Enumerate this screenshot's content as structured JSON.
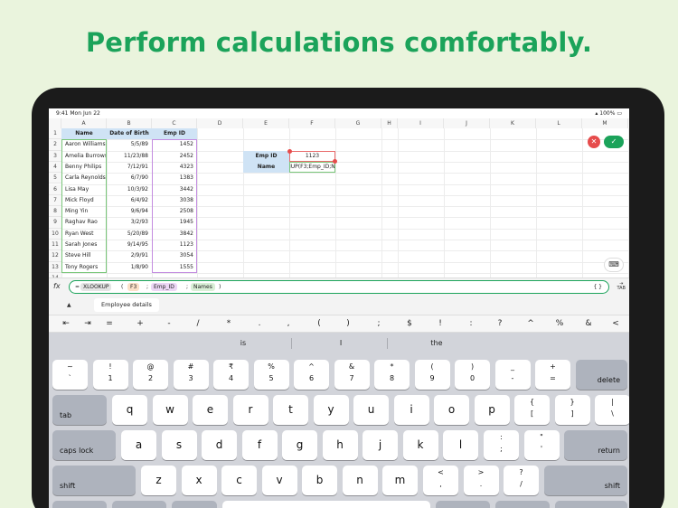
{
  "headline": "Perform calculations comfortably.",
  "status": {
    "time_date": "9:41  Mon Jun 22",
    "battery": "100%"
  },
  "columns": [
    "A",
    "B",
    "C",
    "D",
    "E",
    "F",
    "G",
    "H",
    "I",
    "J",
    "K",
    "L",
    "M",
    "N"
  ],
  "rows": [
    "1",
    "2",
    "3",
    "4",
    "5",
    "6",
    "7",
    "8",
    "9",
    "10",
    "11",
    "12",
    "13",
    "14"
  ],
  "sheet": {
    "headers": {
      "name": "Name",
      "dob": "Date of Birth",
      "empid": "Emp ID"
    },
    "data": [
      [
        "Aaron Williams",
        "5/5/89",
        "1452"
      ],
      [
        "Amelia Burrows",
        "11/23/88",
        "2452"
      ],
      [
        "Benny Philips",
        "7/12/91",
        "4323"
      ],
      [
        "Carla Reynolds",
        "6/7/90",
        "1383"
      ],
      [
        "Lisa May",
        "10/3/92",
        "3442"
      ],
      [
        "Mick Floyd",
        "6/4/92",
        "3038"
      ],
      [
        "Ming Yin",
        "9/6/94",
        "2508"
      ],
      [
        "Raghav Rao",
        "3/2/93",
        "1945"
      ],
      [
        "Ryan West",
        "5/20/89",
        "3842"
      ],
      [
        "Sarah Jones",
        "9/14/95",
        "1123"
      ],
      [
        "Steve Hill",
        "2/9/91",
        "3054"
      ],
      [
        "Tony Rogers",
        "1/8/90",
        "1555"
      ]
    ],
    "lookup": {
      "label_id": "Emp ID",
      "value_id": "1123",
      "label_name": "Name",
      "value_name": "IUP(F3;Emp_ID;Na"
    }
  },
  "formula": {
    "fx": "fx",
    "eq": "=",
    "func": "XLOOKUP",
    "open": "(",
    "arg1": "F3",
    "sep": ";",
    "arg2": "Emp_ID",
    "arg3": "Names",
    "close": ")",
    "braces": "{ }",
    "tab": "TAB"
  },
  "suggestion": {
    "arrow": "▲",
    "item": "Employee details"
  },
  "symbols": [
    "⇤",
    "⇥",
    "=",
    "+",
    "-",
    "/",
    "*",
    ".",
    ",",
    "(",
    ")",
    ";",
    "$",
    "!",
    ":",
    "?",
    "^",
    "%",
    "&",
    "<"
  ],
  "predictions": [
    "is",
    "I",
    "the"
  ],
  "keys": {
    "row1": [
      [
        "~",
        "`"
      ],
      [
        "!",
        "1"
      ],
      [
        "@",
        "2"
      ],
      [
        "#",
        "3"
      ],
      [
        "₹",
        "4"
      ],
      [
        "%",
        "5"
      ],
      [
        "^",
        "6"
      ],
      [
        "&",
        "7"
      ],
      [
        "*",
        "8"
      ],
      [
        "(",
        "9"
      ],
      [
        ")",
        "0"
      ],
      [
        "_",
        "-"
      ],
      [
        "+",
        "="
      ]
    ],
    "delete": "delete",
    "tab": "tab",
    "row2": [
      "q",
      "w",
      "e",
      "r",
      "t",
      "y",
      "u",
      "i",
      "o",
      "p"
    ],
    "row2sym": [
      [
        "{",
        "["
      ],
      [
        "}",
        "]"
      ],
      [
        "|",
        "\\"
      ]
    ],
    "caps": "caps lock",
    "row3": [
      "a",
      "s",
      "d",
      "f",
      "g",
      "h",
      "j",
      "k",
      "l"
    ],
    "row3sym": [
      [
        ":",
        ";"
      ],
      [
        "\"",
        "'"
      ]
    ],
    "return": "return",
    "shift": "shift",
    "row4": [
      "z",
      "x",
      "c",
      "v",
      "b",
      "n",
      "m"
    ],
    "row4sym": [
      [
        "<",
        ","
      ],
      [
        ">",
        "."
      ],
      [
        "?",
        "/"
      ]
    ]
  },
  "colors": {
    "accent": "#1ba35a",
    "cancel": "#e64b4b",
    "header_bg": "#cfe3f5"
  }
}
